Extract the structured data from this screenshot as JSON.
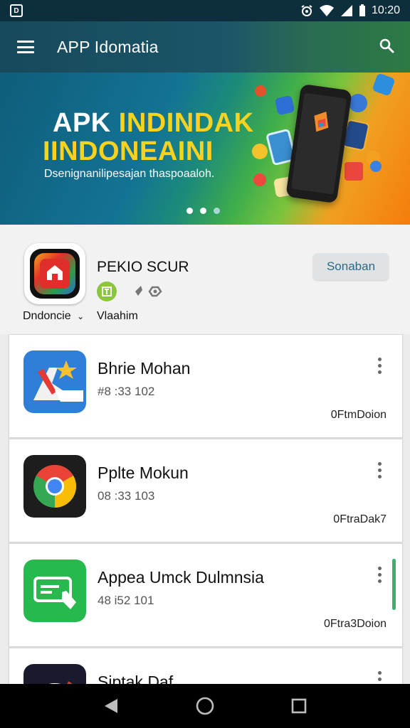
{
  "status_bar": {
    "time": "10:20"
  },
  "app_bar": {
    "title": "APP Idomatia"
  },
  "banner": {
    "headline_1a": "APK ",
    "headline_1b": "INDINDAK",
    "headline_2": "IINDONEAINI",
    "subtitle": "Dsenignanilipesajan thaspoaaloh.",
    "active_slide": 1,
    "slide_count": 3
  },
  "featured": {
    "title": "PEKIO SCUR",
    "region": "Dndoncie",
    "label": "Vlaahim",
    "button": "Sonaban"
  },
  "apps": [
    {
      "name": "Bhrie Mohan",
      "meta": "#8 :33 102",
      "developer": "0FtmDoion",
      "icon": "photo-app-icon"
    },
    {
      "name": "Pplte Mokun",
      "meta": "08 :33 103",
      "developer": "0FtraDak7",
      "icon": "chrome-icon"
    },
    {
      "name": "Appea Umck Dulmnsia",
      "meta": "48 i52 101",
      "developer": "0Ftra3Doion",
      "icon": "card-tap-icon"
    },
    {
      "name": "Siptak Daf",
      "meta": "",
      "developer": "",
      "icon": "speed-icon"
    }
  ],
  "colors": {
    "status_bar": "#0d2f3d",
    "app_bar": "#164a5c",
    "accent": "#2b6a86",
    "nav_bar": "#000000"
  }
}
